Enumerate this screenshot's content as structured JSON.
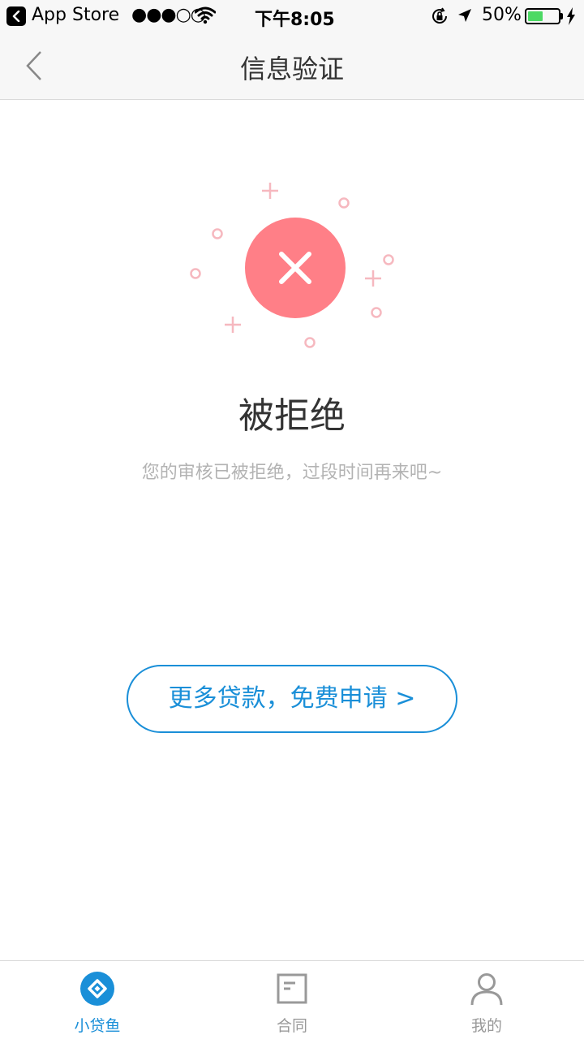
{
  "status_bar": {
    "back_app": "App Store",
    "signal": "●●●○○",
    "time": "下午8:05",
    "battery_percent": "50%",
    "battery_level": 0.5,
    "icons": [
      "back-icon",
      "wifi-icon",
      "orientation-lock-icon",
      "location-icon",
      "battery-icon",
      "charging-icon"
    ]
  },
  "nav": {
    "title": "信息验证",
    "back_icon": "chevron-left-icon"
  },
  "result": {
    "icon": "reject-x-icon",
    "title": "被拒绝",
    "subtitle": "您的审核已被拒绝，过段时间再来吧~"
  },
  "action": {
    "apply_label": "更多贷款，免费申请 >"
  },
  "tabs": [
    {
      "label": "小贷鱼",
      "icon": "diamond-icon",
      "active": true
    },
    {
      "label": "合同",
      "icon": "contract-icon",
      "active": false
    },
    {
      "label": "我的",
      "icon": "user-icon",
      "active": false
    }
  ],
  "colors": {
    "accent": "#1a8fd8",
    "reject": "#ff7f87",
    "decor": "#f6b8bf",
    "battery": "#4cd964"
  }
}
